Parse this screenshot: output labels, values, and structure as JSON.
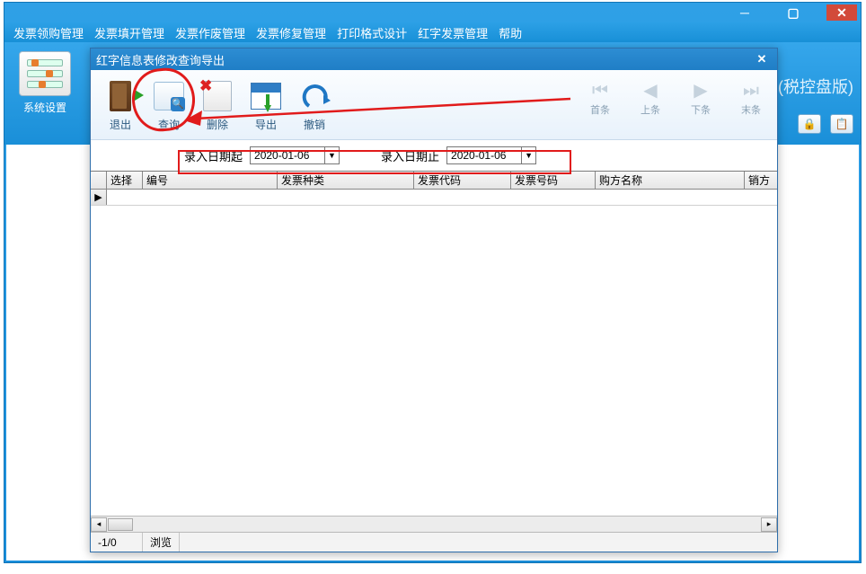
{
  "main_window": {
    "menu": [
      "发票领购管理",
      "发票填开管理",
      "发票作废管理",
      "发票修复管理",
      "打印格式设计",
      "红字发票管理",
      "帮助"
    ],
    "sys_settings_label": "系统设置",
    "version_suffix_label": "(税控盘版)"
  },
  "dialog": {
    "title": "红字信息表修改查询导出",
    "toolbar": {
      "exit": "退出",
      "query": "查询",
      "delete": "删除",
      "export": "导出",
      "undo": "撤销"
    },
    "nav": {
      "first": "首条",
      "prev": "上条",
      "next": "下条",
      "last": "末条"
    },
    "filter": {
      "start_label": "录入日期起",
      "start_value": "2020-01-06",
      "end_label": "录入日期止",
      "end_value": "2020-01-06"
    },
    "grid": {
      "columns": [
        "",
        "选择",
        "编号",
        "发票种类",
        "发票代码",
        "发票号码",
        "购方名称",
        "销方"
      ],
      "row_indicator": "▶"
    },
    "status": {
      "pos": "-1/0",
      "mode": "浏览"
    }
  }
}
